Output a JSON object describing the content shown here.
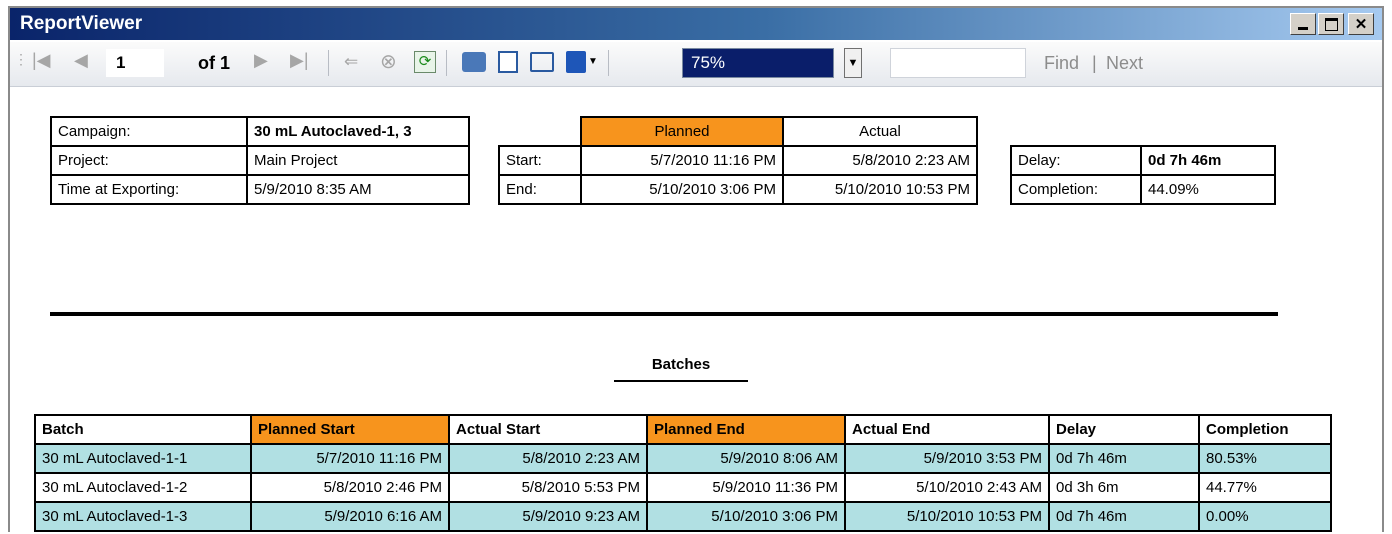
{
  "window": {
    "title": "ReportViewer"
  },
  "toolbar": {
    "page_value": "1",
    "page_of": "of 1",
    "zoom_value": "75%",
    "find_label": "Find",
    "find_sep": "|",
    "next_label": "Next"
  },
  "summary": {
    "campaign_label": "Campaign:",
    "campaign_value": "30 mL Autoclaved-1, 3",
    "project_label": "Project:",
    "project_value": "Main Project",
    "export_label": "Time at Exporting:",
    "export_value": "5/9/2010 8:35 AM"
  },
  "schedule": {
    "planned_header": "Planned",
    "actual_header": "Actual",
    "start_label": "Start:",
    "start_planned": "5/7/2010 11:16 PM",
    "start_actual": "5/8/2010 2:23 AM",
    "end_label": "End:",
    "end_planned": "5/10/2010 3:06 PM",
    "end_actual": "5/10/2010 10:53 PM"
  },
  "status": {
    "delay_label": "Delay:",
    "delay_value": "0d 7h 46m",
    "completion_label": "Completion:",
    "completion_value": "44.09%"
  },
  "batches": {
    "title": "Batches",
    "headers": [
      "Batch",
      "Planned Start",
      "Actual Start",
      "Planned End",
      "Actual End",
      "Delay",
      "Completion"
    ],
    "rows": [
      [
        "30 mL Autoclaved-1-1",
        "5/7/2010 11:16 PM",
        "5/8/2010 2:23 AM",
        "5/9/2010 8:06 AM",
        "5/9/2010 3:53 PM",
        "0d 7h 46m",
        "80.53%"
      ],
      [
        "30 mL Autoclaved-1-2",
        "5/8/2010 2:46 PM",
        "5/8/2010 5:53 PM",
        "5/9/2010 11:36 PM",
        "5/10/2010 2:43 AM",
        "0d 3h 6m",
        "44.77%"
      ],
      [
        "30 mL Autoclaved-1-3",
        "5/9/2010 6:16 AM",
        "5/9/2010 9:23 AM",
        "5/10/2010 3:06 PM",
        "5/10/2010 10:53 PM",
        "0d 7h 46m",
        "0.00%"
      ]
    ]
  },
  "colors": {
    "header_highlight": "#f7941d",
    "row_highlight": "#b1e0e3",
    "title_bar": "#0a246a"
  }
}
